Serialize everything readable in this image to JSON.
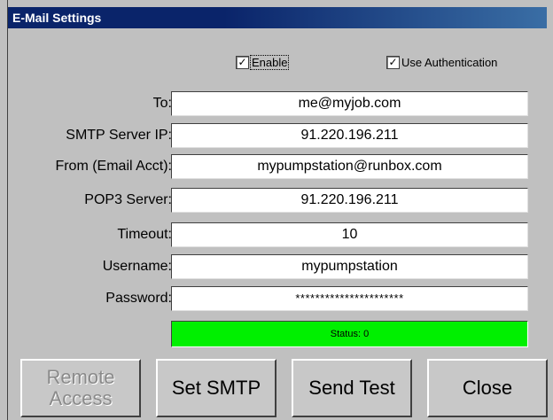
{
  "window": {
    "title": "E-Mail Settings"
  },
  "options": {
    "enable_label": "Enable",
    "enable_checked": true,
    "auth_label": "Use Authentication",
    "auth_checked": true
  },
  "fields": {
    "to": {
      "label": "To:",
      "value": "me@myjob.com"
    },
    "smtp": {
      "label": "SMTP Server IP:",
      "value": "91.220.196.211"
    },
    "from": {
      "label": "From (Email Acct):",
      "value": "mypumpstation@runbox.com"
    },
    "pop3": {
      "label": "POP3 Server:",
      "value": "91.220.196.211"
    },
    "timeout": {
      "label": "Timeout:",
      "value": "10"
    },
    "username": {
      "label": "Username:",
      "value": "mypumpstation"
    },
    "password": {
      "label": "Password:",
      "value": "**********************"
    }
  },
  "status": {
    "text": "Status: 0",
    "color": "#00f000"
  },
  "buttons": {
    "remote_line1": "Remote",
    "remote_line2": "Access",
    "set_smtp": "Set SMTP",
    "send_test": "Send Test",
    "close": "Close"
  },
  "glyphs": {
    "check": "✓"
  }
}
